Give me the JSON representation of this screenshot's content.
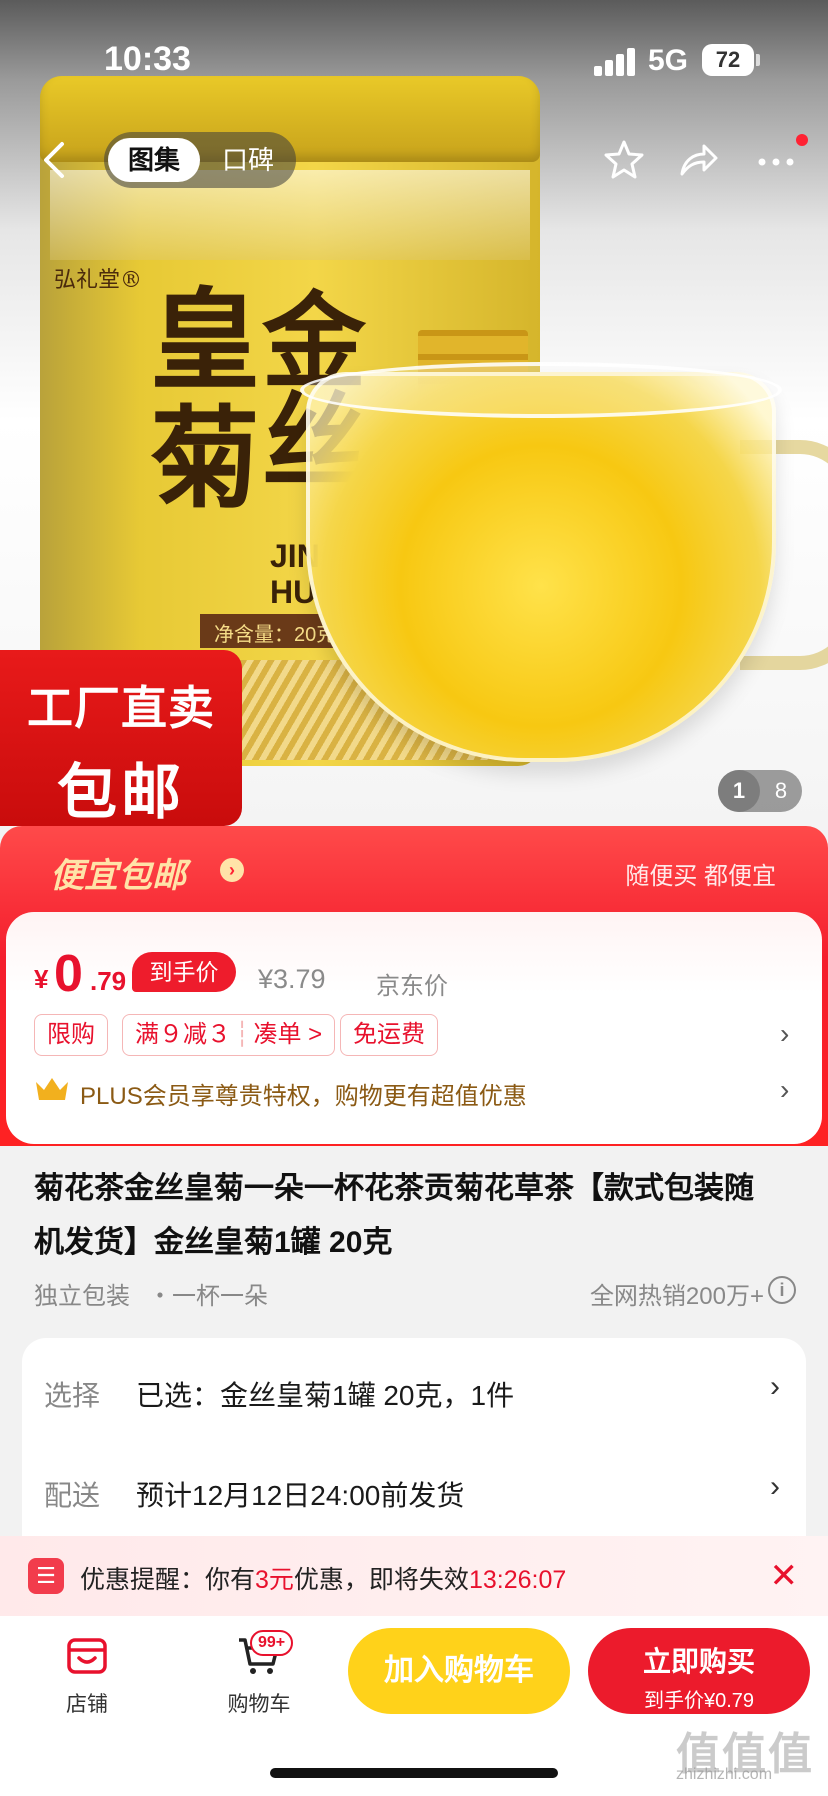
{
  "status_bar": {
    "time": "10:33",
    "network": "5G",
    "battery": "72"
  },
  "nav": {
    "tabs": [
      "图集",
      "口碑"
    ]
  },
  "image": {
    "brand": "弘礼堂®",
    "big_chars": [
      "皇",
      "菊",
      "金",
      "丝"
    ],
    "pinyin": [
      "JIN",
      "HU"
    ],
    "net_content": "净含量：20克",
    "promo_line1": "工厂直卖",
    "promo_line2": "包邮",
    "pager_current": "1",
    "pager_total": "8"
  },
  "banner": {
    "title": "便宜包邮",
    "right_text": "随便买 都便宜"
  },
  "price": {
    "currency": "¥",
    "integer": "0",
    "decimal": ".79",
    "pill": "到手价",
    "jd_price": "¥3.79",
    "jd_label": "京东价"
  },
  "chips": {
    "limit": "限购",
    "discount": "满９减３",
    "bundle": "凑单 >",
    "free_shipping": "免运费"
  },
  "plus": {
    "text": "PLUS会员享尊贵特权，购物更有超值优惠"
  },
  "product": {
    "title": "菊花茶金丝皇菊一朵一杯花茶贡菊花草茶【款式包装随机发货】金丝皇菊1罐 20克",
    "tag1": "独立包装",
    "tag2": "・一杯一朵",
    "hot_sales": "全网热销200万+"
  },
  "options": {
    "select_key": "选择",
    "select_val": "已选：金丝皇菊1罐 20克，1件",
    "delivery_key": "配送",
    "delivery_val": "预计12月12日24:00前发货"
  },
  "reminder": {
    "label": "优惠提醒：你有",
    "amount": "3元",
    "mid": "优惠，即将失效",
    "countdown": "13:26:07"
  },
  "bottom": {
    "store": "店铺",
    "cart": "购物车",
    "cart_badge": "99+",
    "add_cart": "加入购物车",
    "buy_now": "立即购买",
    "buy_price": "到手价¥0.79"
  },
  "watermark": {
    "text": "值值值",
    "sub": "zhizhizhi.com"
  },
  "colors": {
    "accent_red": "#ec1b2c",
    "cart_yellow": "#ffd21a",
    "banner_gold": "#ffe3a8"
  }
}
